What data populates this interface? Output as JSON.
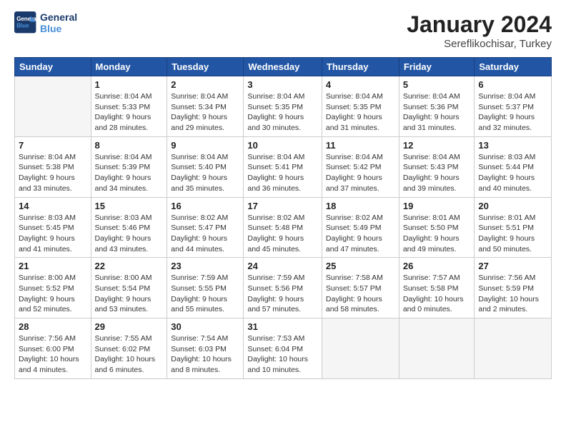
{
  "header": {
    "logo_line1": "General",
    "logo_line2": "Blue",
    "month": "January 2024",
    "location": "Sereflikochisar, Turkey"
  },
  "weekdays": [
    "Sunday",
    "Monday",
    "Tuesday",
    "Wednesday",
    "Thursday",
    "Friday",
    "Saturday"
  ],
  "weeks": [
    [
      {
        "day": "",
        "info": ""
      },
      {
        "day": "1",
        "info": "Sunrise: 8:04 AM\nSunset: 5:33 PM\nDaylight: 9 hours\nand 28 minutes."
      },
      {
        "day": "2",
        "info": "Sunrise: 8:04 AM\nSunset: 5:34 PM\nDaylight: 9 hours\nand 29 minutes."
      },
      {
        "day": "3",
        "info": "Sunrise: 8:04 AM\nSunset: 5:35 PM\nDaylight: 9 hours\nand 30 minutes."
      },
      {
        "day": "4",
        "info": "Sunrise: 8:04 AM\nSunset: 5:35 PM\nDaylight: 9 hours\nand 31 minutes."
      },
      {
        "day": "5",
        "info": "Sunrise: 8:04 AM\nSunset: 5:36 PM\nDaylight: 9 hours\nand 31 minutes."
      },
      {
        "day": "6",
        "info": "Sunrise: 8:04 AM\nSunset: 5:37 PM\nDaylight: 9 hours\nand 32 minutes."
      }
    ],
    [
      {
        "day": "7",
        "info": "Sunrise: 8:04 AM\nSunset: 5:38 PM\nDaylight: 9 hours\nand 33 minutes."
      },
      {
        "day": "8",
        "info": "Sunrise: 8:04 AM\nSunset: 5:39 PM\nDaylight: 9 hours\nand 34 minutes."
      },
      {
        "day": "9",
        "info": "Sunrise: 8:04 AM\nSunset: 5:40 PM\nDaylight: 9 hours\nand 35 minutes."
      },
      {
        "day": "10",
        "info": "Sunrise: 8:04 AM\nSunset: 5:41 PM\nDaylight: 9 hours\nand 36 minutes."
      },
      {
        "day": "11",
        "info": "Sunrise: 8:04 AM\nSunset: 5:42 PM\nDaylight: 9 hours\nand 37 minutes."
      },
      {
        "day": "12",
        "info": "Sunrise: 8:04 AM\nSunset: 5:43 PM\nDaylight: 9 hours\nand 39 minutes."
      },
      {
        "day": "13",
        "info": "Sunrise: 8:03 AM\nSunset: 5:44 PM\nDaylight: 9 hours\nand 40 minutes."
      }
    ],
    [
      {
        "day": "14",
        "info": "Sunrise: 8:03 AM\nSunset: 5:45 PM\nDaylight: 9 hours\nand 41 minutes."
      },
      {
        "day": "15",
        "info": "Sunrise: 8:03 AM\nSunset: 5:46 PM\nDaylight: 9 hours\nand 43 minutes."
      },
      {
        "day": "16",
        "info": "Sunrise: 8:02 AM\nSunset: 5:47 PM\nDaylight: 9 hours\nand 44 minutes."
      },
      {
        "day": "17",
        "info": "Sunrise: 8:02 AM\nSunset: 5:48 PM\nDaylight: 9 hours\nand 45 minutes."
      },
      {
        "day": "18",
        "info": "Sunrise: 8:02 AM\nSunset: 5:49 PM\nDaylight: 9 hours\nand 47 minutes."
      },
      {
        "day": "19",
        "info": "Sunrise: 8:01 AM\nSunset: 5:50 PM\nDaylight: 9 hours\nand 49 minutes."
      },
      {
        "day": "20",
        "info": "Sunrise: 8:01 AM\nSunset: 5:51 PM\nDaylight: 9 hours\nand 50 minutes."
      }
    ],
    [
      {
        "day": "21",
        "info": "Sunrise: 8:00 AM\nSunset: 5:52 PM\nDaylight: 9 hours\nand 52 minutes."
      },
      {
        "day": "22",
        "info": "Sunrise: 8:00 AM\nSunset: 5:54 PM\nDaylight: 9 hours\nand 53 minutes."
      },
      {
        "day": "23",
        "info": "Sunrise: 7:59 AM\nSunset: 5:55 PM\nDaylight: 9 hours\nand 55 minutes."
      },
      {
        "day": "24",
        "info": "Sunrise: 7:59 AM\nSunset: 5:56 PM\nDaylight: 9 hours\nand 57 minutes."
      },
      {
        "day": "25",
        "info": "Sunrise: 7:58 AM\nSunset: 5:57 PM\nDaylight: 9 hours\nand 58 minutes."
      },
      {
        "day": "26",
        "info": "Sunrise: 7:57 AM\nSunset: 5:58 PM\nDaylight: 10 hours\nand 0 minutes."
      },
      {
        "day": "27",
        "info": "Sunrise: 7:56 AM\nSunset: 5:59 PM\nDaylight: 10 hours\nand 2 minutes."
      }
    ],
    [
      {
        "day": "28",
        "info": "Sunrise: 7:56 AM\nSunset: 6:00 PM\nDaylight: 10 hours\nand 4 minutes."
      },
      {
        "day": "29",
        "info": "Sunrise: 7:55 AM\nSunset: 6:02 PM\nDaylight: 10 hours\nand 6 minutes."
      },
      {
        "day": "30",
        "info": "Sunrise: 7:54 AM\nSunset: 6:03 PM\nDaylight: 10 hours\nand 8 minutes."
      },
      {
        "day": "31",
        "info": "Sunrise: 7:53 AM\nSunset: 6:04 PM\nDaylight: 10 hours\nand 10 minutes."
      },
      {
        "day": "",
        "info": ""
      },
      {
        "day": "",
        "info": ""
      },
      {
        "day": "",
        "info": ""
      }
    ]
  ]
}
